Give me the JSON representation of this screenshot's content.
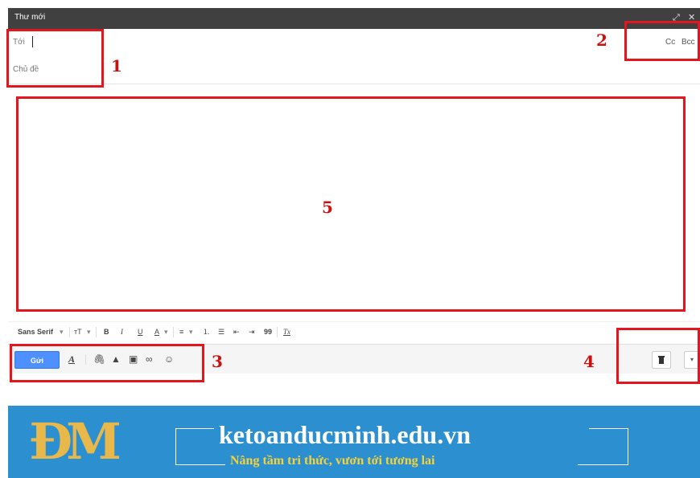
{
  "window": {
    "title": "Thư mới",
    "minimize_symbol": "_",
    "popout_symbol": "⤢",
    "close_symbol": "✕"
  },
  "fields": {
    "to_label": "Tới",
    "subject_label": "Chủ đề",
    "cc_label": "Cc",
    "bcc_label": "Bcc"
  },
  "annotations": {
    "n1": "1",
    "n2": "2",
    "n3": "3",
    "n4": "4",
    "n5": "5",
    "box_color": "#e2161c"
  },
  "format_toolbar": {
    "font": "Sans Serif",
    "font_dropdown": "▾",
    "size": "тT",
    "size_dropdown": "▾",
    "bold": "B",
    "italic": "I",
    "underline": "U",
    "text_color": "A",
    "color_dropdown": "▾",
    "align": "≡",
    "align_dropdown": "▾",
    "numbered_list": "⒈",
    "bullet_list": "☰",
    "indent_less": "⇤",
    "indent_more": "⇥",
    "quote": "99",
    "clear_format": "Tx"
  },
  "bottom_toolbar": {
    "send_label": "Gửi",
    "send_color": "#4d90fe",
    "formatting_toggle": "A",
    "attach": "🖇",
    "drive": "▲",
    "photo": "▣",
    "link": "∞",
    "emoji": "☺",
    "more": "▾"
  },
  "banner": {
    "logo_text": "ĐM",
    "site": "ketoanducminh.edu.vn",
    "tagline": "Nâng tầm tri thức, vươn tới tương lai",
    "background": "#2c8fd0",
    "logo_color": "#e8b84a",
    "tagline_color": "#f5d33a"
  }
}
